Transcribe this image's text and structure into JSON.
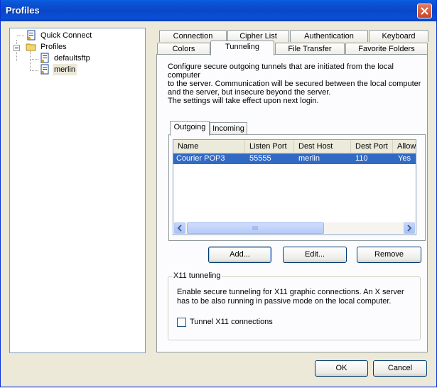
{
  "window": {
    "title": "Profiles"
  },
  "tree": {
    "items": [
      {
        "label": "Quick Connect",
        "icon": "document-key-icon"
      },
      {
        "label": "Profiles",
        "icon": "folder-icon"
      },
      {
        "label": "defaultsftp",
        "icon": "document-key-icon"
      },
      {
        "label": "merlin",
        "icon": "document-key-icon",
        "selected": true
      }
    ]
  },
  "tabs": {
    "row1": [
      "Connection",
      "Cipher List",
      "Authentication",
      "Keyboard"
    ],
    "row2": [
      "Colors",
      "Tunneling",
      "File Transfer",
      "Favorite Folders"
    ],
    "active": "Tunneling"
  },
  "tunneling": {
    "description": "Configure secure outgoing tunnels that are initiated from the local computer to the server. Communication will be secured between the local computer and the server, but insecure beyond the server. The settings will take effect upon next login.",
    "desc_lines": [
      "Configure secure outgoing tunnels that are initiated from the local computer",
      "to the server. Communication will be secured between the local computer",
      "and the server, but insecure beyond the server.",
      "The settings will take effect upon next login."
    ],
    "subtabs": [
      "Outgoing",
      "Incoming"
    ],
    "active_subtab": "Outgoing",
    "columns": [
      "Name",
      "Listen Port",
      "Dest Host",
      "Dest Port",
      "Allow"
    ],
    "rows": [
      [
        "Courier POP3",
        "55555",
        "merlin",
        "110",
        "Yes"
      ]
    ],
    "buttons": {
      "add": "Add...",
      "edit": "Edit...",
      "remove": "Remove"
    }
  },
  "x11": {
    "title": "X11 tunneling",
    "text_lines": [
      "Enable secure tunneling for X11 graphic connections. An X server",
      "has to be also running in passive mode on the local computer."
    ],
    "checkbox_label": "Tunnel X11 connections",
    "checked": false
  },
  "footer": {
    "ok": "OK",
    "cancel": "Cancel"
  },
  "colors": {
    "selection": "#316ac5",
    "titlebar": "#0a47c8"
  }
}
